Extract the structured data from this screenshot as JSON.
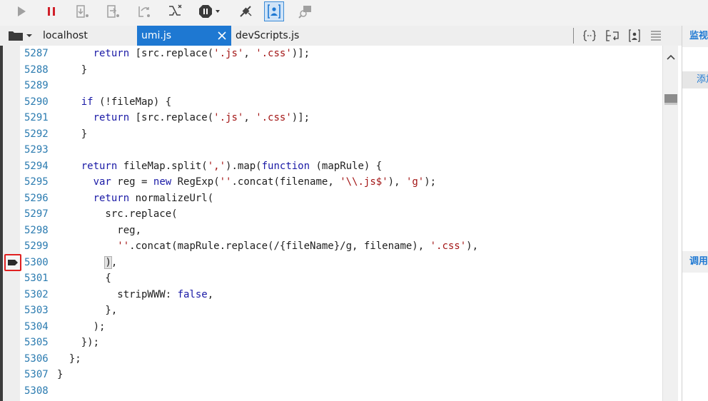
{
  "toolbar": {
    "buttons": [
      {
        "name": "continue-icon"
      },
      {
        "name": "break-icon"
      },
      {
        "name": "step-into-icon"
      },
      {
        "name": "step-over-icon"
      },
      {
        "name": "step-out-icon"
      },
      {
        "name": "break-on-new-worker-icon"
      },
      {
        "name": "exception-behavior-icon"
      },
      {
        "name": "disconnect-debugger-icon"
      },
      {
        "name": "just-my-code-icon"
      },
      {
        "name": "find-icon"
      }
    ]
  },
  "tabs": [
    {
      "label": "localhost",
      "active": false
    },
    {
      "label": "umi.js",
      "active": true
    },
    {
      "label": "devScripts.js",
      "active": false
    }
  ],
  "tab_tools": [
    "pretty-print-icon",
    "word-wrap-icon",
    "source-map-icon",
    "more-icon"
  ],
  "right_panel": {
    "watch_title": "监视",
    "add_watch": "添加",
    "callstack_title": "调用"
  },
  "code_lines": [
    {
      "n": "5287",
      "t": "      return [src.replace('.js', '.css')];"
    },
    {
      "n": "5288",
      "t": "    }"
    },
    {
      "n": "5289",
      "t": ""
    },
    {
      "n": "5290",
      "t": "    if (!fileMap) {"
    },
    {
      "n": "5291",
      "t": "      return [src.replace('.js', '.css')];"
    },
    {
      "n": "5292",
      "t": "    }"
    },
    {
      "n": "5293",
      "t": ""
    },
    {
      "n": "5294",
      "t": "    return fileMap.split(',').map(function (mapRule) {"
    },
    {
      "n": "5295",
      "t": "      var reg = new RegExp(''.concat(filename, '\\\\.js$'), 'g');"
    },
    {
      "n": "5296",
      "t": "      return normalizeUrl("
    },
    {
      "n": "5297",
      "t": "        src.replace("
    },
    {
      "n": "5298",
      "t": "          reg,"
    },
    {
      "n": "5299",
      "t": "          ''.concat(mapRule.replace(/{fileName}/g, filename), '.css'),"
    },
    {
      "n": "5300",
      "t": "        ),"
    },
    {
      "n": "5301",
      "t": "        {"
    },
    {
      "n": "5302",
      "t": "          stripWWW: false,"
    },
    {
      "n": "5303",
      "t": "        },"
    },
    {
      "n": "5304",
      "t": "      );"
    },
    {
      "n": "5305",
      "t": "    });"
    },
    {
      "n": "5306",
      "t": "  };"
    },
    {
      "n": "5307",
      "t": "}"
    },
    {
      "n": "5308",
      "t": ""
    }
  ],
  "current_line": "5300",
  "colors": {
    "accent": "#1e78d2",
    "keyword": "#1a1aa6",
    "string": "#a31515",
    "line_number": "#2b7bb0",
    "breakpoint_outline": "#e02020"
  }
}
